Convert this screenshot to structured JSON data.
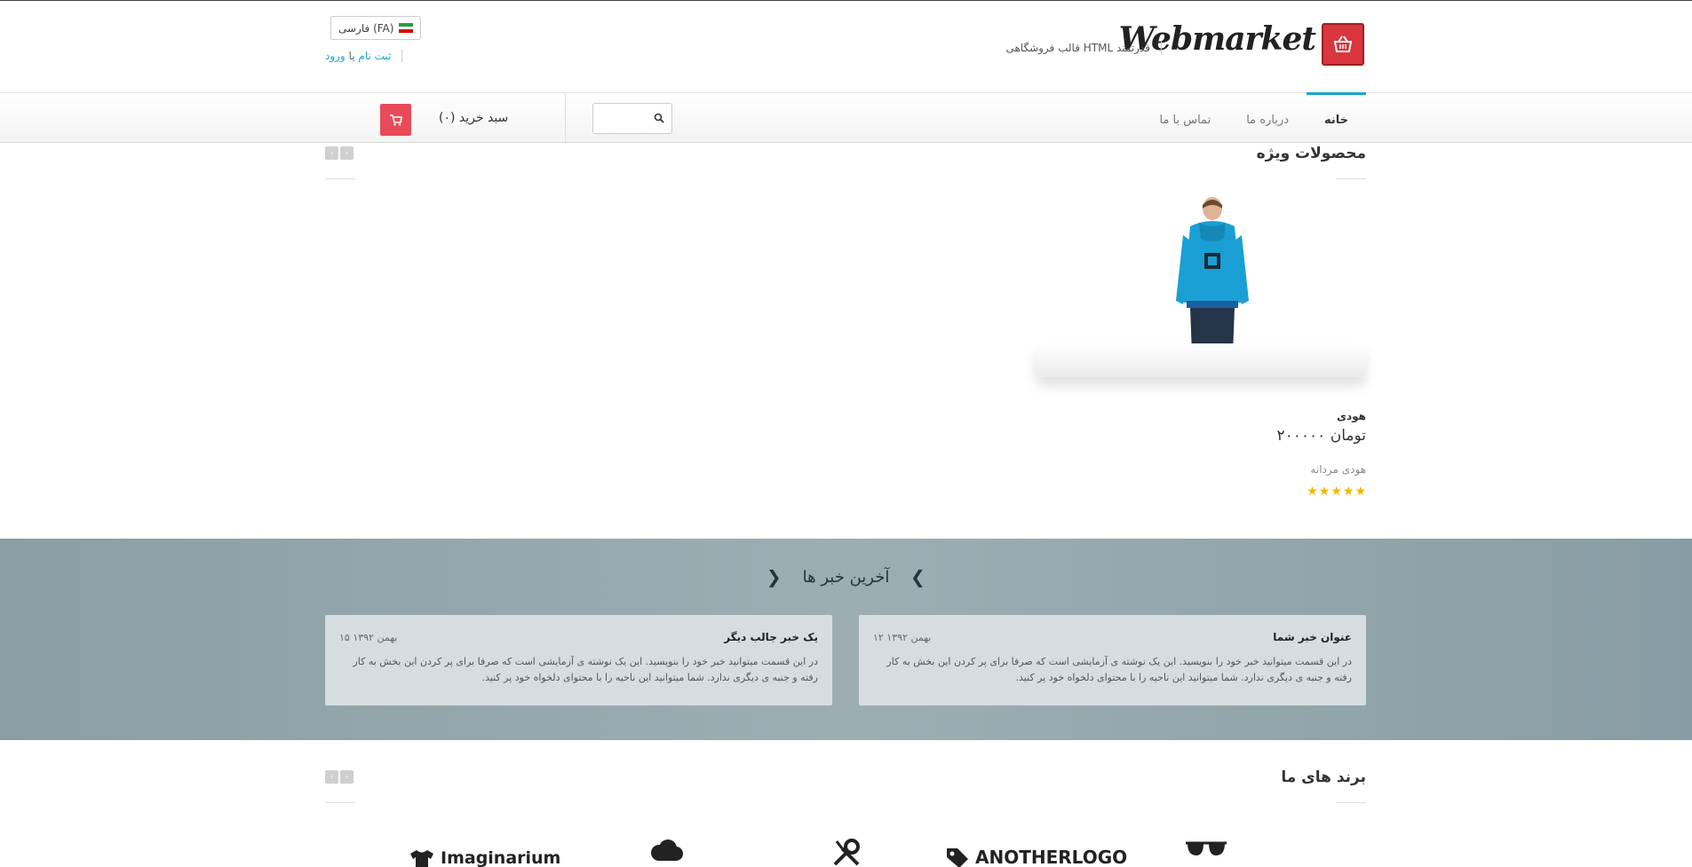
{
  "header": {
    "brand_name": "Webmarket",
    "tagline": "قالب فروشگاهی HTML قدرتمند",
    "language_label": "فارسی (FA)",
    "login_text": "ورود",
    "or_text": "یا",
    "register_text": "ثبت نام"
  },
  "nav": {
    "items": [
      {
        "label": "خانه",
        "active": true
      },
      {
        "label": "درباره ما",
        "active": false
      },
      {
        "label": "تماس با ما",
        "active": false
      }
    ],
    "search_placeholder": "",
    "cart_label": "سبد خرید (۰)"
  },
  "featured": {
    "title": "محصولات ویژه",
    "product": {
      "name": "هودی",
      "price": "۲۰۰۰۰۰ تومان",
      "description": "هودی مردانه",
      "rating": 5
    }
  },
  "news": {
    "title": "آخرین خبر ها",
    "items": [
      {
        "title": "عنوان خبر شما",
        "date": "۱۲ بهمن ۱۳۹۲",
        "body": "در این قسمت میتوانید خبر خود را بنویسید. این یک نوشته ی آزمایشی است که صرفا برای پر کردن این بخش به کار رفته و جنبه ی دیگری ندارد. شما میتوانید این ناحیه را با محتوای دلخواه خود پر کنید."
      },
      {
        "title": "یک خبر جالب دیگر",
        "date": "۱۵ بهمن ۱۳۹۲",
        "body": "در این قسمت میتوانید خبر خود را بنویسید. این یک نوشته ی آزمایشی است که صرفا برای پر کردن این بخش به کار رفته و جنبه ی دیگری ندارد. شما میتوانید این ناحیه را با محتوای دلخواه خود پر کنید."
      }
    ]
  },
  "brands": {
    "title": "برند های ما",
    "logos": [
      "Imaginarium",
      "ANOTHERLOGO"
    ]
  },
  "colors": {
    "accent": "#1aa6c9",
    "brand_red": "#d9363e",
    "cart_red": "#e94a5a",
    "star": "#f2b600"
  }
}
